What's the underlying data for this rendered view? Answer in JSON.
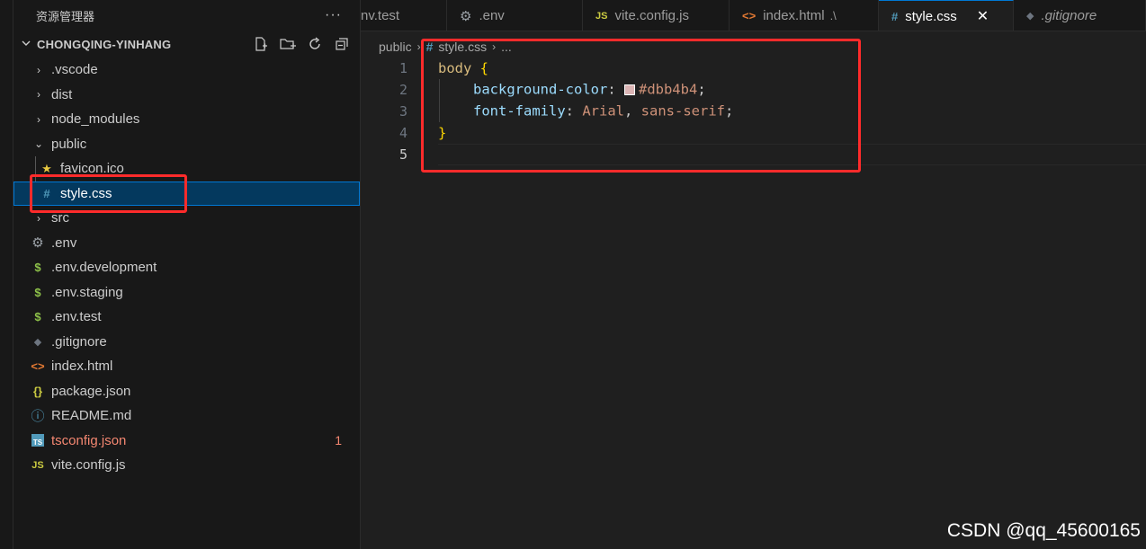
{
  "sidebar": {
    "title": "资源管理器",
    "more_label": "···",
    "project_name": "CHONGQING-YINHANG",
    "items": [
      {
        "label": ".vscode",
        "kind": "folder",
        "collapsed": true
      },
      {
        "label": "dist",
        "kind": "folder",
        "collapsed": true
      },
      {
        "label": "node_modules",
        "kind": "folder",
        "collapsed": true
      },
      {
        "label": "public",
        "kind": "folder",
        "collapsed": false
      },
      {
        "label": "favicon.ico",
        "kind": "file",
        "icon": "star-icon"
      },
      {
        "label": "style.css",
        "kind": "file",
        "icon": "hash-icon",
        "selected": true
      },
      {
        "label": "src",
        "kind": "folder",
        "collapsed": true
      },
      {
        "label": ".env",
        "kind": "file",
        "icon": "gear-icon"
      },
      {
        "label": ".env.development",
        "kind": "file",
        "icon": "dollar-icon"
      },
      {
        "label": ".env.staging",
        "kind": "file",
        "icon": "dollar-icon"
      },
      {
        "label": ".env.test",
        "kind": "file",
        "icon": "dollar-icon"
      },
      {
        "label": ".gitignore",
        "kind": "file",
        "icon": "git-icon"
      },
      {
        "label": "index.html",
        "kind": "file",
        "icon": "html-icon"
      },
      {
        "label": "package.json",
        "kind": "file",
        "icon": "json-icon"
      },
      {
        "label": "README.md",
        "kind": "file",
        "icon": "info-icon"
      },
      {
        "label": "tsconfig.json",
        "kind": "file",
        "icon": "ts-icon",
        "badge": "1"
      },
      {
        "label": "vite.config.js",
        "kind": "file",
        "icon": "js-icon"
      }
    ]
  },
  "tabs": [
    {
      "label": "nv.test",
      "icon": ""
    },
    {
      "label": ".env",
      "icon": "gear-icon"
    },
    {
      "label": "vite.config.js",
      "icon": "js-icon"
    },
    {
      "label": "index.html",
      "suffix": ".\\",
      "icon": "html-icon"
    },
    {
      "label": "style.css",
      "icon": "hash-icon",
      "active": true,
      "close": "✕"
    },
    {
      "label": ".gitignore",
      "icon": "git-icon",
      "italic": true
    }
  ],
  "breadcrumb": {
    "folder": "public",
    "file": "style.css",
    "more": "..."
  },
  "editor": {
    "line_numbers": [
      "1",
      "2",
      "3",
      "4",
      "5"
    ],
    "selector": "body",
    "open_brace": "{",
    "close_brace": "}",
    "prop1": "background-color",
    "val1": "#dbb4b4",
    "prop2": "font-family",
    "val2a": "Arial",
    "val2b": "sans-serif",
    "swatch_color": "#dbb4b4"
  },
  "icon_glyphs": {
    "dollar": "$",
    "hash": "#",
    "js": "JS",
    "ts": "TS",
    "json": "{}",
    "html": "<>",
    "info": "ⓘ",
    "star": "★",
    "gear": "⚙",
    "git": "◆"
  },
  "colors": {
    "accent": "#0078d4",
    "selection": "#04395e",
    "annotation": "#ff2b2b"
  },
  "watermark": "CSDN @qq_45600165"
}
